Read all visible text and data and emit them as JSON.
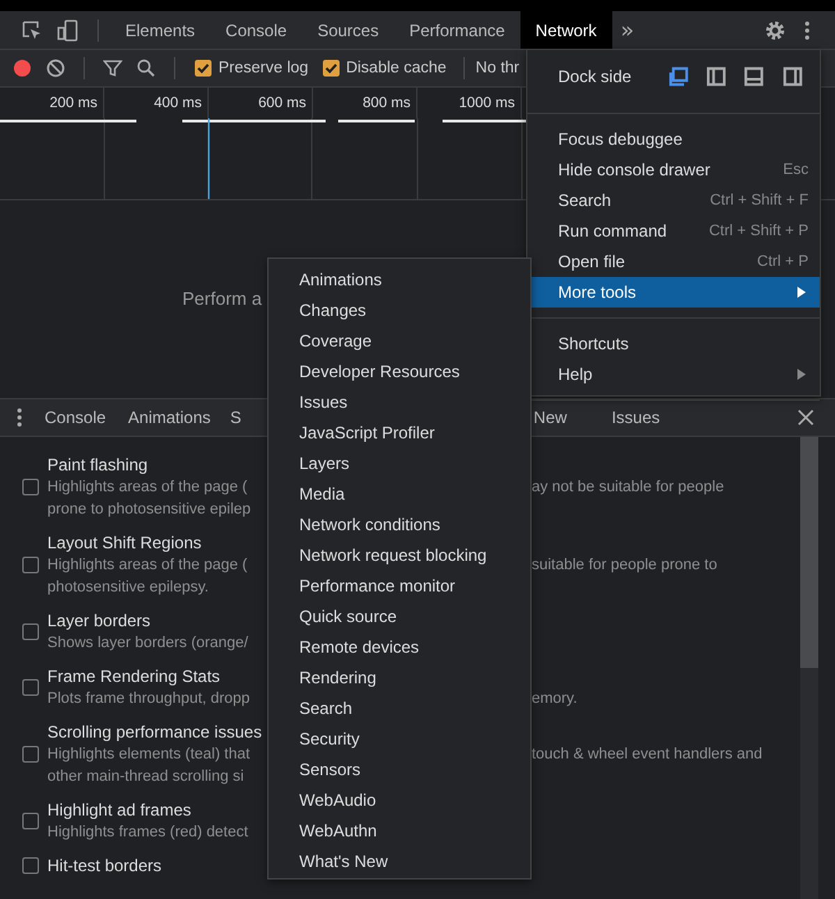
{
  "main_tabs": [
    {
      "label": "Elements",
      "selected": false
    },
    {
      "label": "Console",
      "selected": false
    },
    {
      "label": "Sources",
      "selected": false
    },
    {
      "label": "Performance",
      "selected": false
    },
    {
      "label": "Network",
      "selected": true
    }
  ],
  "overflow_tabs": "»",
  "network_toolbar": {
    "recording": true,
    "checkboxes": [
      {
        "label": "Preserve log",
        "checked": true
      },
      {
        "label": "Disable cache",
        "checked": true
      }
    ],
    "throttling": "No thr"
  },
  "timeline": {
    "ticks": [
      "200 ms",
      "400 ms",
      "600 ms",
      "800 ms",
      "1000 ms"
    ]
  },
  "empty_state": {
    "line_2": "Perform a"
  },
  "drawer_tabs": [
    {
      "label": "Console",
      "selected": false
    },
    {
      "label": "Animations",
      "selected": false
    },
    {
      "label": "S",
      "selected": false
    },
    {
      "label": "New",
      "selected": false
    },
    {
      "label": "Issues",
      "selected": false
    }
  ],
  "rendering_options": [
    {
      "title": "Paint flashing",
      "checked": false,
      "lines": [
        {
          "left": "Highlights areas of the page (",
          "right": "ay not be suitable for people"
        },
        {
          "left": "prone to photosensitive epilep"
        }
      ]
    },
    {
      "title": "Layout Shift Regions",
      "checked": false,
      "lines": [
        {
          "left": "Highlights areas of the page (",
          "right": "suitable for people prone to"
        },
        {
          "left": "photosensitive epilepsy."
        }
      ]
    },
    {
      "title": "Layer borders",
      "checked": false,
      "lines": [
        {
          "left": "Shows layer borders (orange/"
        }
      ]
    },
    {
      "title": "Frame Rendering Stats",
      "checked": false,
      "lines": [
        {
          "left": "Plots frame throughput, dropp",
          "right": "emory."
        }
      ]
    },
    {
      "title": "Scrolling performance issues",
      "checked": false,
      "lines": [
        {
          "left": "Highlights elements (teal) that",
          "right": "touch & wheel event handlers and"
        },
        {
          "left": "other main-thread scrolling si"
        }
      ]
    },
    {
      "title": "Highlight ad frames",
      "checked": false,
      "lines": [
        {
          "left": "Highlights frames (red) detect"
        }
      ]
    },
    {
      "title": "Hit-test borders",
      "checked": false
    }
  ],
  "main_menu": {
    "dock_side": {
      "label": "Dock side",
      "options": [
        {
          "kind": "undock",
          "selected": true
        },
        {
          "kind": "left",
          "selected": false
        },
        {
          "kind": "bottom",
          "selected": false
        },
        {
          "kind": "right",
          "selected": false
        }
      ]
    },
    "groups": [
      [
        {
          "label": "Focus debuggee",
          "selected": false
        },
        {
          "label": "Hide console drawer",
          "shortcut": "Esc",
          "selected": false
        },
        {
          "label": "Search",
          "shortcut": "Ctrl + Shift + F",
          "selected": false
        },
        {
          "label": "Run command",
          "shortcut": "Ctrl + Shift + P",
          "selected": false
        },
        {
          "label": "Open file",
          "shortcut": "Ctrl + P",
          "selected": false
        },
        {
          "label": "More tools",
          "submenu": true,
          "selected": true
        }
      ],
      [
        {
          "label": "Shortcuts",
          "selected": false
        },
        {
          "label": "Help",
          "submenu": true,
          "selected": false
        }
      ]
    ]
  },
  "more_tools_menu": [
    "Animations",
    "Changes",
    "Coverage",
    "Developer Resources",
    "Issues",
    "JavaScript Profiler",
    "Layers",
    "Media",
    "Network conditions",
    "Network request blocking",
    "Performance monitor",
    "Quick source",
    "Remote devices",
    "Rendering",
    "Search",
    "Security",
    "Sensors",
    "WebAudio",
    "WebAuthn",
    "What's New"
  ]
}
